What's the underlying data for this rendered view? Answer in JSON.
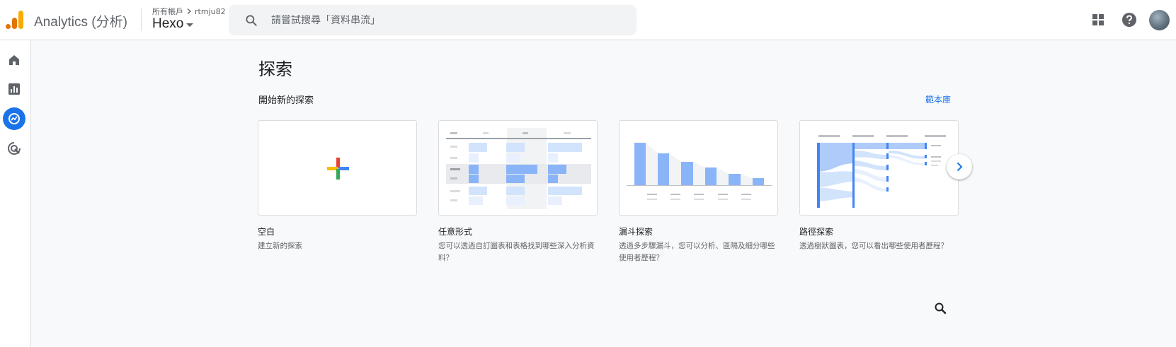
{
  "header": {
    "app_title": "Analytics (分析)",
    "account_label": "所有帳戶",
    "account_name": "rtmju82",
    "property_name": "Hexo",
    "search_placeholder": "請嘗試搜尋「資料串流」"
  },
  "rail": {
    "items": [
      {
        "name": "home",
        "icon": "home-icon"
      },
      {
        "name": "reports",
        "icon": "bar-chart-icon"
      },
      {
        "name": "explore",
        "icon": "explore-icon",
        "active": true
      },
      {
        "name": "advertising",
        "icon": "advertising-icon"
      }
    ]
  },
  "main": {
    "title": "探索",
    "section_title": "開始新的探索",
    "gallery_link": "範本庫",
    "cards": [
      {
        "name": "空白",
        "desc": "建立新的探索",
        "thumb_icon": "plus-icon"
      },
      {
        "name": "任意形式",
        "desc": "您可以透過自訂圖表和表格找到哪些深入分析資料？",
        "thumb_icon": "free-form-thumbnail"
      },
      {
        "name": "漏斗探索",
        "desc": "透過多步驟漏斗，您可以分析、區隔及細分哪些使用者歷程？",
        "thumb_icon": "funnel-thumbnail"
      },
      {
        "name": "路徑探索",
        "desc": "透過樹狀圖表，您可以看出哪些使用者歷程？",
        "thumb_icon": "path-thumbnail"
      }
    ]
  },
  "colors": {
    "accent": "#1a73e8",
    "thumb_blue": "#8ab4f8",
    "thumb_light_blue": "#d2e3fc",
    "thumb_gray": "#e8eaed"
  }
}
